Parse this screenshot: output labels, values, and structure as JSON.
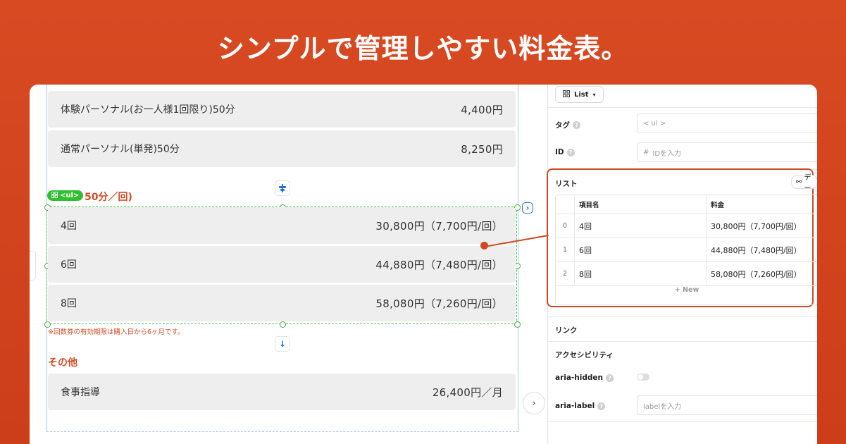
{
  "headline": "シンプルで管理しやすい料金表。",
  "canvas": {
    "top_rows": [
      {
        "name": "体験パーソナル(お一人様1回限り)50分",
        "price": "4,400円"
      },
      {
        "name": "通常パーソナル(単発)50分",
        "price": "8,250円"
      }
    ],
    "section_title_partial": "50分／回)",
    "ul_badge": "<ul>",
    "ticket_rows": [
      {
        "name": "4回",
        "price": "30,800円（7,700円/回）"
      },
      {
        "name": "6回",
        "price": "44,880円（7,480円/回）"
      },
      {
        "name": "8回",
        "price": "58,080円（7,260円/回）"
      }
    ],
    "note": "※回数券の有効期限は購入日から6ヶ月です。",
    "other_title": "その他",
    "other_rows": [
      {
        "name": "食事指導",
        "price": "26,400円／月"
      }
    ]
  },
  "panel": {
    "component_label": "List",
    "tag_label": "タグ",
    "tag_value": "< ul >",
    "id_label": "ID",
    "id_placeholder": "IDを入力",
    "list_label": "リスト",
    "data_button": "デー",
    "table": {
      "headers": [
        "項目名",
        "料金"
      ],
      "rows": [
        {
          "index": "0",
          "name": "4回",
          "price": "30,800円（7,700円/回）"
        },
        {
          "index": "1",
          "name": "6回",
          "price": "44,880円（7,480円/回）"
        },
        {
          "index": "2",
          "name": "8回",
          "price": "58,080円（7,260円/回）"
        }
      ],
      "new_label": "+ New"
    },
    "link_label": "リンク",
    "a11y_label": "アクセシビリティ",
    "aria_hidden_label": "aria-hidden",
    "aria_label_label": "aria-label",
    "aria_label_placeholder": "labelを入力"
  },
  "colors": {
    "background": "#d84a22",
    "accent": "#cc4a23",
    "selection": "#2fbf2f"
  },
  "icons": [
    "grid-icon",
    "chevron-down-icon",
    "help-icon",
    "link-icon",
    "arrow-down-icon",
    "align-icon",
    "chevron-right-icon"
  ]
}
